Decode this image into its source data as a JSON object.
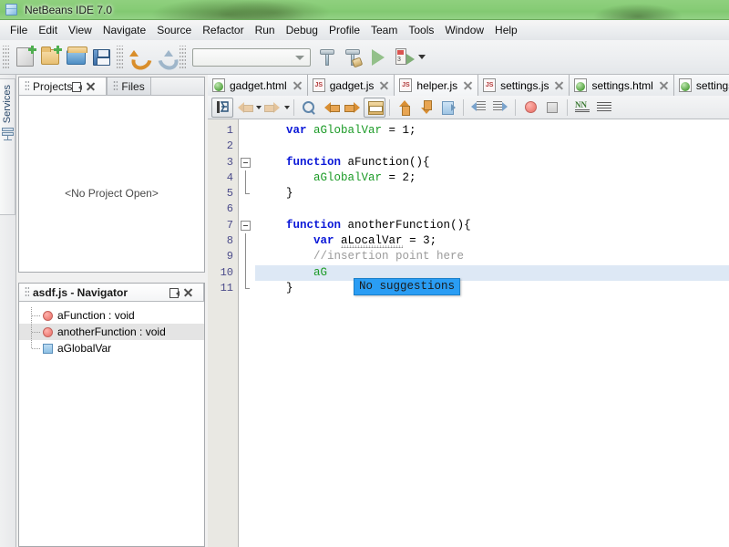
{
  "window": {
    "title": "NetBeans IDE 7.0",
    "app_icon": "netbeans-cube-icon"
  },
  "menubar": {
    "items": [
      {
        "label": "File"
      },
      {
        "label": "Edit"
      },
      {
        "label": "View"
      },
      {
        "label": "Navigate"
      },
      {
        "label": "Source"
      },
      {
        "label": "Refactor"
      },
      {
        "label": "Run"
      },
      {
        "label": "Debug"
      },
      {
        "label": "Profile"
      },
      {
        "label": "Team"
      },
      {
        "label": "Tools"
      },
      {
        "label": "Window"
      },
      {
        "label": "Help"
      }
    ]
  },
  "toolbar": {
    "buttons": [
      {
        "name": "new-file-icon"
      },
      {
        "name": "new-project-icon"
      },
      {
        "name": "open-project-icon"
      },
      {
        "name": "save-all-icon"
      },
      {
        "name": "undo-icon"
      },
      {
        "name": "redo-icon"
      }
    ],
    "config_combo": {
      "value": "",
      "placeholder": ""
    },
    "right_buttons": [
      {
        "name": "build-project-icon"
      },
      {
        "name": "clean-and-build-icon"
      },
      {
        "name": "run-project-icon"
      },
      {
        "name": "debug-project-icon"
      }
    ]
  },
  "left_dock": {
    "services_tab_label": "Services"
  },
  "projects_panel": {
    "tabs": [
      {
        "label": "Projects",
        "active": true
      },
      {
        "label": "Files",
        "active": false
      }
    ],
    "empty_message": "<No Project Open>",
    "minimize_label": "Minimize Window",
    "close_label": "Close Window"
  },
  "navigator_panel": {
    "title": "asdf.js - Navigator",
    "items": [
      {
        "label": "aFunction : void",
        "icon": "function-icon",
        "selected": false
      },
      {
        "label": "anotherFunction : void",
        "icon": "function-icon",
        "selected": true
      },
      {
        "label": "aGlobalVar",
        "icon": "variable-icon",
        "selected": false
      }
    ]
  },
  "editor": {
    "tabs": [
      {
        "label": "gadget.html",
        "type": "html",
        "active": false
      },
      {
        "label": "gadget.js",
        "type": "js",
        "active": false
      },
      {
        "label": "helper.js",
        "type": "js",
        "active": true
      },
      {
        "label": "settings.js",
        "type": "js",
        "active": false
      },
      {
        "label": "settings.html",
        "type": "html",
        "active": false
      },
      {
        "label": "settings.htm",
        "type": "html",
        "active": false
      }
    ],
    "toolbar_buttons": [
      {
        "name": "toggle-bookmark-icon"
      },
      {
        "name": "previous-bookmark-icon"
      },
      {
        "name": "next-bookmark-icon"
      },
      {
        "name": "find-selection-icon"
      },
      {
        "name": "find-previous-icon"
      },
      {
        "name": "find-next-icon"
      },
      {
        "name": "toggle-highlight-search-icon"
      },
      {
        "name": "previous-error-icon"
      },
      {
        "name": "next-error-icon"
      },
      {
        "name": "last-edit-icon"
      },
      {
        "name": "shift-line-left-icon"
      },
      {
        "name": "shift-line-right-icon"
      },
      {
        "name": "start-macro-recording-icon"
      },
      {
        "name": "stop-macro-recording-icon"
      },
      {
        "name": "inspect-members-icon"
      },
      {
        "name": "inspect-hierarchy-icon"
      }
    ],
    "line_numbers": [
      "1",
      "2",
      "3",
      "4",
      "5",
      "6",
      "7",
      "8",
      "9",
      "10",
      "11"
    ],
    "current_line": 10,
    "lines": [
      {
        "n": 1,
        "tokens": [
          {
            "t": "var",
            "c": "kw"
          },
          {
            "t": " ",
            "c": "plain"
          },
          {
            "t": "aGlobalVar",
            "c": "id"
          },
          {
            "t": " = 1;",
            "c": "plain"
          }
        ]
      },
      {
        "n": 2,
        "tokens": []
      },
      {
        "n": 3,
        "tokens": [
          {
            "t": "function",
            "c": "kw"
          },
          {
            "t": " ",
            "c": "plain"
          },
          {
            "t": "aFunction",
            "c": "plain"
          },
          {
            "t": "(){",
            "c": "plain"
          }
        ]
      },
      {
        "n": 4,
        "tokens": [
          {
            "t": "    ",
            "c": "plain"
          },
          {
            "t": "aGlobalVar",
            "c": "id"
          },
          {
            "t": " = 2;",
            "c": "plain"
          }
        ]
      },
      {
        "n": 5,
        "tokens": [
          {
            "t": "}",
            "c": "plain"
          }
        ]
      },
      {
        "n": 6,
        "tokens": []
      },
      {
        "n": 7,
        "tokens": [
          {
            "t": "function",
            "c": "kw"
          },
          {
            "t": " ",
            "c": "plain"
          },
          {
            "t": "anotherFunction",
            "c": "plain"
          },
          {
            "t": "(){",
            "c": "plain"
          }
        ]
      },
      {
        "n": 8,
        "tokens": [
          {
            "t": "    ",
            "c": "plain"
          },
          {
            "t": "var",
            "c": "kw"
          },
          {
            "t": " ",
            "c": "plain"
          },
          {
            "t": "aLocalVar",
            "c": "warn"
          },
          {
            "t": " = 3;",
            "c": "plain"
          }
        ]
      },
      {
        "n": 9,
        "tokens": [
          {
            "t": "    //insertion point here",
            "c": "cmt"
          }
        ]
      },
      {
        "n": 10,
        "tokens": [
          {
            "t": "    ",
            "c": "plain"
          },
          {
            "t": "aG",
            "c": "id"
          }
        ]
      },
      {
        "n": 11,
        "tokens": [
          {
            "t": "}",
            "c": "plain"
          }
        ]
      }
    ],
    "code_plain": "var aGlobalVar = 1;\n\nfunction aFunction(){\n    aGlobalVar = 2;\n}\n\nfunction anotherFunction(){\n    var aLocalVar = 3;\n    //insertion point here\n    aG\n}",
    "fold_markers": [
      {
        "start": 3,
        "end": 5
      },
      {
        "start": 7,
        "end": 11
      }
    ],
    "completion_popup": {
      "text": "No suggestions",
      "background": "#2a9df4"
    }
  },
  "colors": {
    "keyword": "#0b18d8",
    "identifier": "#1a9a25",
    "comment": "#9b9b9b",
    "current_line_highlight": "#dde8f5",
    "popup_blue": "#2a9df4",
    "title_bar_green": "#87cc76",
    "gutter": "#e9e8e3"
  }
}
